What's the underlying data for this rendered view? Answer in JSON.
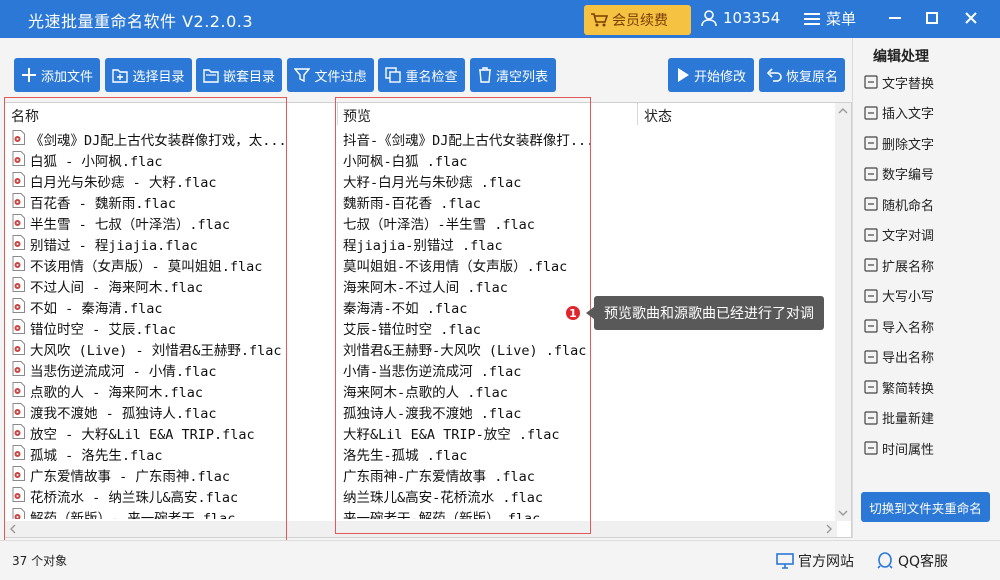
{
  "app": {
    "title": "光速批量重命名软件 V2.2.0.3",
    "vip_label": "会员续费",
    "user_id": "103354",
    "menu_label": "菜单"
  },
  "toolbar": {
    "add_file": "添加文件",
    "select_dir": "选择目录",
    "nested_dir": "嵌套目录",
    "file_filter": "文件过虑",
    "dup_check": "重名检查",
    "clear_list": "清空列表",
    "start_modify": "开始修改",
    "restore_name": "恢复原名"
  },
  "table": {
    "columns": [
      "名称",
      "预览",
      "状态"
    ],
    "rows": [
      {
        "name": "《剑魂》DJ配上古代女装群像打戏，太...",
        "preview": "抖音-《剑魂》DJ配上古代女装群像打..."
      },
      {
        "name": "白狐 - 小阿枫.flac",
        "preview": "小阿枫-白狐 .flac"
      },
      {
        "name": "白月光与朱砂痣 - 大籽.flac",
        "preview": "大籽-白月光与朱砂痣 .flac"
      },
      {
        "name": "百花香 - 魏新雨.flac",
        "preview": "魏新雨-百花香 .flac"
      },
      {
        "name": "半生雪 - 七叔（叶泽浩）.flac",
        "preview": "七叔（叶泽浩）-半生雪 .flac"
      },
      {
        "name": "别错过 - 程jiajia.flac",
        "preview": "程jiajia-别错过 .flac"
      },
      {
        "name": "不该用情（女声版）- 莫叫姐姐.flac",
        "preview": "莫叫姐姐-不该用情（女声版）.flac"
      },
      {
        "name": "不过人间 - 海来阿木.flac",
        "preview": "海来阿木-不过人间 .flac"
      },
      {
        "name": "不如 - 秦海清.flac",
        "preview": "秦海清-不如 .flac"
      },
      {
        "name": "错位时空 - 艾辰.flac",
        "preview": "艾辰-错位时空 .flac"
      },
      {
        "name": "大风吹 (Live) - 刘惜君&王赫野.flac",
        "preview": "刘惜君&王赫野-大风吹 (Live) .flac"
      },
      {
        "name": "当悲伤逆流成河 - 小倩.flac",
        "preview": "小倩-当悲伤逆流成河 .flac"
      },
      {
        "name": "点歌的人 - 海来阿木.flac",
        "preview": "海来阿木-点歌的人 .flac"
      },
      {
        "name": "渡我不渡她 - 孤独诗人.flac",
        "preview": "孤独诗人-渡我不渡她 .flac"
      },
      {
        "name": "放空 - 大籽&Lil E&A TRIP.flac",
        "preview": "大籽&Lil E&A TRIP-放空 .flac"
      },
      {
        "name": "孤城 - 洛先生.flac",
        "preview": "洛先生-孤城 .flac"
      },
      {
        "name": "广东爱情故事 - 广东雨神.flac",
        "preview": "广东雨神-广东爱情故事 .flac"
      },
      {
        "name": "花桥流水 - 纳兰珠儿&高安.flac",
        "preview": "纳兰珠儿&高安-花桥流水 .flac"
      },
      {
        "name": "解药（新版）- 来一碗老干.flac",
        "preview": "来一碗老干-解药（新版）.flac"
      }
    ]
  },
  "annotation": {
    "number": "1",
    "text": "预览歌曲和源歌曲已经进行了对调"
  },
  "sidebar": {
    "title": "编辑处理",
    "items": [
      "文字替换",
      "插入文字",
      "删除文字",
      "数字编号",
      "随机命名",
      "文字对调",
      "扩展名称",
      "大写小写",
      "导入名称",
      "导出名称",
      "繁简转换",
      "批量新建",
      "时间属性"
    ],
    "switch_label": "切换到文件夹重命名"
  },
  "status": {
    "count": "37 个对象",
    "website": "官方网站",
    "qq": "QQ客服"
  },
  "colors": {
    "primary": "#2b78d6",
    "vip": "#f5c242",
    "annotation_bg": "#595959",
    "annotation_dot": "#e0262c",
    "highlight_box": "#e15a5a"
  }
}
